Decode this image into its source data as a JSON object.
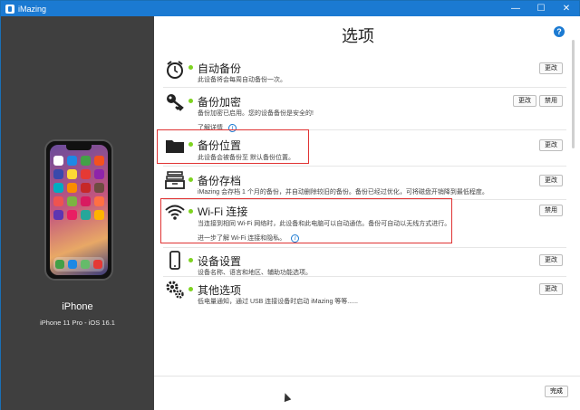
{
  "window": {
    "title": "iMazing"
  },
  "titlebar_buttons": [
    {
      "name": "minimize",
      "glyph": "—"
    },
    {
      "name": "maximize",
      "glyph": "☐"
    },
    {
      "name": "close",
      "glyph": "✕"
    }
  ],
  "device": {
    "name": "iPhone",
    "model": "iPhone 11 Pro - iOS 16.1"
  },
  "page": {
    "title": "选项",
    "help_glyph": "?"
  },
  "options": [
    {
      "icon": "alarm-clock-icon",
      "title": "自动备份",
      "desc": "此设备将会每周自动备份一次。",
      "buttons": [
        "更改"
      ]
    },
    {
      "icon": "key-icon",
      "title": "备份加密",
      "desc": "备份加密已启用。您的设备备份是安全的!",
      "sub": "了解详情",
      "buttons": [
        "更改",
        "禁用"
      ]
    },
    {
      "icon": "folder-icon",
      "title": "备份位置",
      "desc": "此设备会被备份至 默认备份位置。",
      "buttons": [
        "更改"
      ]
    },
    {
      "icon": "archive-icon",
      "title": "备份存档",
      "desc": "iMazing 会存档 1 个月的备份，并自动删除较旧的备份。备份已经过优化，可将磁盘开销降到最低程度。",
      "buttons": [
        "更改"
      ]
    },
    {
      "icon": "wifi-icon",
      "title": "Wi-Fi 连接",
      "desc": "当连接到相同 Wi-Fi 网络时，此设备和此电脑可以自动通信。备份可自动以无线方式进行。",
      "sub": "进一步了解 Wi-Fi 连接和隐私。",
      "buttons": [
        "禁用"
      ]
    },
    {
      "icon": "phone-icon",
      "title": "设备设置",
      "desc": "设备名称、语言和地区、辅助功能选项。",
      "buttons": [
        "更改"
      ]
    },
    {
      "icon": "gears-icon",
      "title": "其他选项",
      "desc": "低电量通知，通过 USB 连接设备时启动 iMazing 等等......",
      "buttons": [
        "更改"
      ]
    }
  ],
  "info_glyph": "i",
  "footer": {
    "done_label": "完成"
  },
  "colors": {
    "accent": "#1b7ad2",
    "status_dot": "#7ed321",
    "highlight": "#e03333",
    "sidebar": "#3f3f3f"
  }
}
